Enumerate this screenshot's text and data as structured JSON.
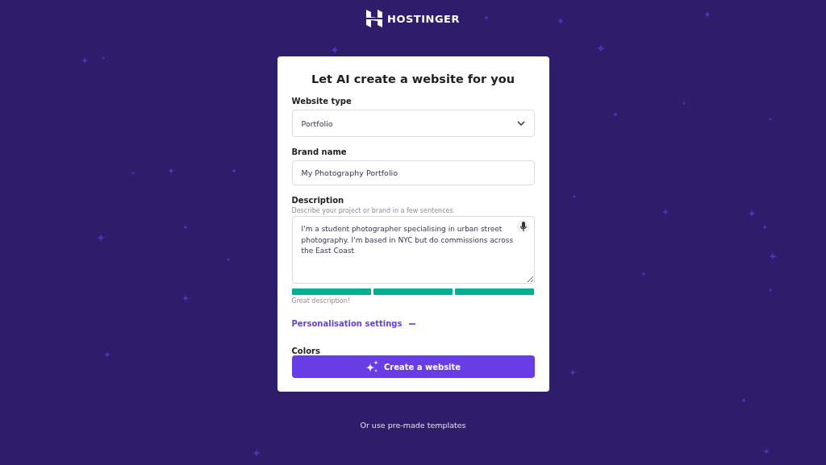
{
  "brand": {
    "name": "HOSTINGER"
  },
  "form": {
    "title": "Let AI create a website for you",
    "website_type": {
      "label": "Website type",
      "value": "Portfolio"
    },
    "brand_name": {
      "label": "Brand name",
      "value": "My Photography Portfolio"
    },
    "description": {
      "label": "Description",
      "hint": "Describe your project or brand in a few sentences.",
      "value": "I'm a student photographer specialising in urban street photography. I'm based in NYC but do commissions across the East Coast",
      "quality_segments": [
        {
          "filled": true
        },
        {
          "filled": true
        },
        {
          "filled": true
        }
      ],
      "quality_text": "Great description!"
    },
    "personalisation": {
      "label": "Personalisation settings",
      "expanded": true
    },
    "colors_label": "Colors",
    "submit": "Create a website"
  },
  "footer_link": "Or use pre-made templates"
}
